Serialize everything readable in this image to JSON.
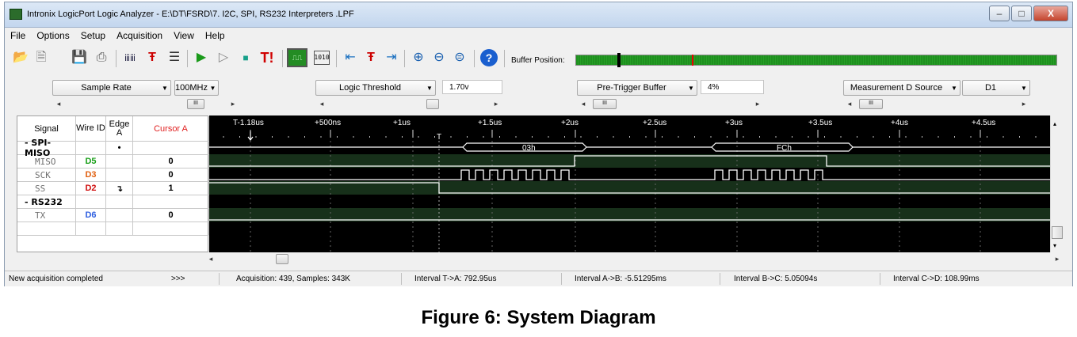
{
  "window": {
    "title": "Intronix LogicPort Logic Analyzer - E:\\DT\\FSRD\\7. I2C, SPI, RS232 Interpreters .LPF",
    "minimize": "–",
    "maximize": "□",
    "close": "X"
  },
  "menu": [
    "File",
    "Options",
    "Setup",
    "Acquisition",
    "View",
    "Help"
  ],
  "toolbar": {
    "icons": [
      "open-folder",
      "new-file",
      "save",
      "print",
      "trigger-pattern",
      "trigger-edit",
      "bus-settings",
      "run-single",
      "run-repeat",
      "stop",
      "force-trigger",
      "waveform-view",
      "state-view",
      "cursor-left",
      "go-to-trigger",
      "cursor-right",
      "zoom-in",
      "zoom-out",
      "zoom-fit",
      "help"
    ],
    "force_trigger_label": "T!",
    "buffer_position_label": "Buffer Position:"
  },
  "controls": {
    "sample_rate": {
      "label": "Sample Rate",
      "value": "100MHz"
    },
    "logic_threshold": {
      "label": "Logic Threshold",
      "value": "1.70v"
    },
    "pre_trigger": {
      "label": "Pre-Trigger Buffer",
      "value": "4%"
    },
    "measurement": {
      "label": "Measurement D Source",
      "value": "D1"
    }
  },
  "grid": {
    "headers": {
      "signal": "Signal",
      "wire": "Wire ID",
      "edge": "Edge A",
      "cursor": "Cursor A"
    },
    "rows": [
      {
        "signal": "- SPI-MISO",
        "wire": "",
        "edge": "•",
        "cursor": "",
        "group": true
      },
      {
        "signal": "MISO",
        "wire": "D5",
        "edge": "",
        "cursor": "0",
        "wire_color": "#1aa01a"
      },
      {
        "signal": "SCK",
        "wire": "D3",
        "edge": "",
        "cursor": "0",
        "wire_color": "#e06010"
      },
      {
        "signal": "SS",
        "wire": "D2",
        "edge": "↴",
        "cursor": "1",
        "wire_color": "#d01010"
      },
      {
        "signal": "- RS232",
        "wire": "",
        "edge": "",
        "cursor": "",
        "group": true
      },
      {
        "signal": "TX",
        "wire": "D6",
        "edge": "",
        "cursor": "0",
        "wire_color": "#3060e0"
      }
    ]
  },
  "timeline": {
    "labels": [
      "T-1.18us",
      "+500ns",
      "+1us",
      "+1.5us",
      "+2us",
      "+2.5us",
      "+3us",
      "+3.5us",
      "+4us",
      "+4.5us"
    ],
    "trigger_marker": "T",
    "bus_values": [
      "03h",
      "FCh"
    ]
  },
  "status": {
    "message": "New acquisition completed",
    "more": ">>>",
    "acquisition": "Acquisition: 439, Samples: 343K",
    "interval_ta": "Interval T->A: 792.95us",
    "interval_ab": "Interval A->B: -5.51295ms",
    "interval_bc": "Interval B->C: 5.05094s",
    "interval_cd": "Interval C->D: 108.99ms"
  },
  "caption": "Figure 6: System Diagram"
}
